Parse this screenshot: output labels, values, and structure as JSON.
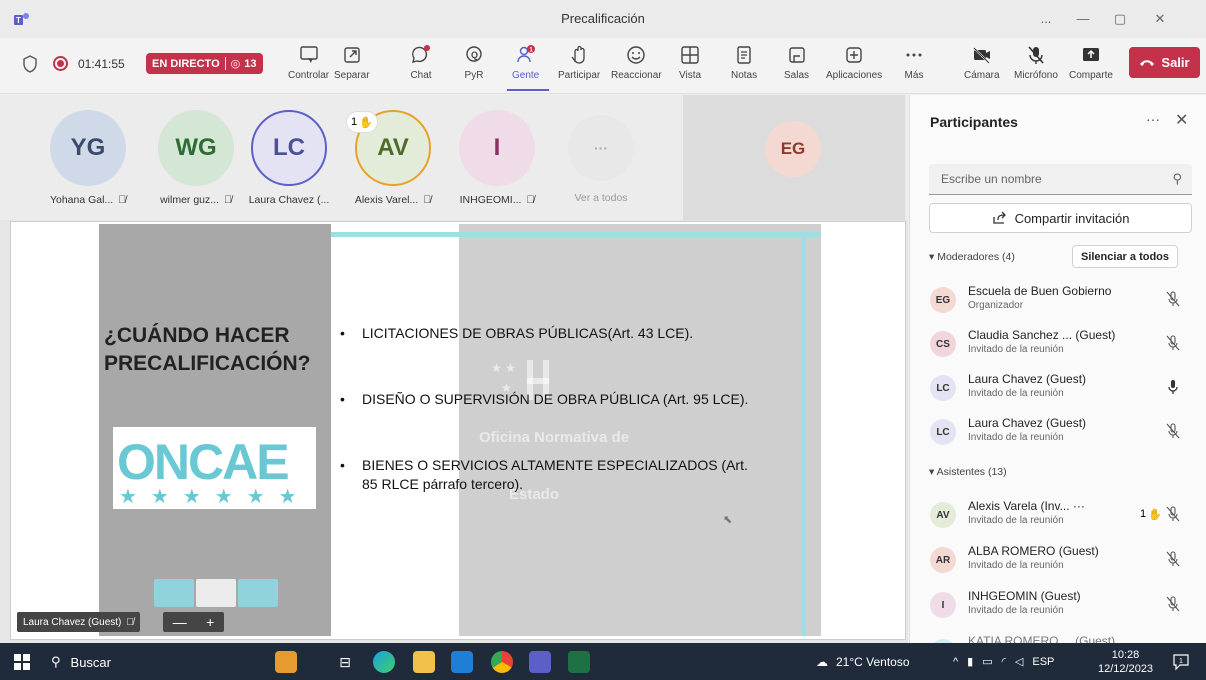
{
  "window": {
    "title": "Precalificación",
    "controls": [
      "...",
      "—",
      "▢",
      "✕"
    ]
  },
  "toolbar": {
    "timer": "01:41:55",
    "live_label": "EN DIRECTO",
    "live_viewers": "13",
    "items": [
      {
        "key": "controlar",
        "label": "Controlar"
      },
      {
        "key": "separar",
        "label": "Separar"
      },
      {
        "key": "chat",
        "label": "Chat"
      },
      {
        "key": "pyr",
        "label": "PyR"
      },
      {
        "key": "gente",
        "label": "Gente",
        "badge": "1"
      },
      {
        "key": "participar",
        "label": "Participar"
      },
      {
        "key": "reaccionar",
        "label": "Reaccionar"
      },
      {
        "key": "vista",
        "label": "Vista"
      },
      {
        "key": "notas",
        "label": "Notas"
      },
      {
        "key": "salas",
        "label": "Salas"
      },
      {
        "key": "aplicaciones",
        "label": "Aplicaciones"
      },
      {
        "key": "mas",
        "label": "Más"
      },
      {
        "key": "camara",
        "label": "Cámara"
      },
      {
        "key": "microfono",
        "label": "Micrófono"
      },
      {
        "key": "comparte",
        "label": "Comparte"
      }
    ],
    "leave_label": "Salir"
  },
  "gallery": {
    "tiles": [
      {
        "initials": "YG",
        "name": "Yohana Gal...",
        "bg": "#cfd9e8",
        "fg": "#3b4a6b"
      },
      {
        "initials": "WG",
        "name": "wilmer guz...",
        "bg": "#d4e6d4",
        "fg": "#2f6b36"
      },
      {
        "initials": "LC",
        "name": "Laura Chavez (...",
        "bg": "#e3e3f3",
        "fg": "#4b4f9c"
      },
      {
        "initials": "AV",
        "name": "Alexis Varel...",
        "bg": "#e3ecd8",
        "fg": "#4e6b2a"
      },
      {
        "initials": "I",
        "name": "INHGEOMI...",
        "bg": "#f0dbe8",
        "fg": "#8c2f64"
      },
      {
        "initials": "···",
        "name": "Ver a todos",
        "bg": "#e8e8e8",
        "fg": "#aaa"
      }
    ],
    "hand_count": "1",
    "featured": {
      "initials": "EG"
    }
  },
  "slide": {
    "title_line1": "¿CUÁNDO HACER",
    "title_line2": "PRECALIFICACIÓN?",
    "bullets": [
      "LICITACIONES DE OBRAS PÚBLICAS(Art. 43 LCE).",
      "DISEÑO O SUPERVISIÓN DE OBRA PÚBLICA (Art. 95 LCE).",
      "BIENES O SERVICIOS ALTAMENTE ESPECIALIZADOS (Art.",
      "85 RLCE párrafo tercero)."
    ],
    "watermark1": "Oficina Normativa de",
    "watermark2": "Estado",
    "logo_text": "ONCAE"
  },
  "presenter": {
    "name": "Laura Chavez (Guest)",
    "zoom_out": "—",
    "zoom_in": "+"
  },
  "panel": {
    "title": "Participantes",
    "more": "···",
    "close": "✕",
    "search_placeholder": "Escribe un nombre",
    "share_invite": "Compartir invitación",
    "moderators_header": "Moderadores (4)",
    "mute_all": "Silenciar a todos",
    "attendees_header": "Asistentes (13)",
    "moderators": [
      {
        "initials": "EG",
        "name": "Escuela de Buen Gobierno",
        "role": "Organizador",
        "bg": "#f4d9d3",
        "mic": "muted"
      },
      {
        "initials": "CS",
        "name": "Claudia Sanchez ... (Guest)",
        "role": "Invitado de la reunión",
        "bg": "#f1d6d9",
        "mic": "muted"
      },
      {
        "initials": "LC",
        "name": "Laura Chavez (Guest)",
        "role": "Invitado de la reunión",
        "bg": "#e3e3f3",
        "mic": "on"
      },
      {
        "initials": "LC",
        "name": "Laura Chavez (Guest)",
        "role": "Invitado de la reunión",
        "bg": "#e3e3f3",
        "mic": "muted"
      }
    ],
    "attendees": [
      {
        "initials": "AV",
        "name": "Alexis Varela (Inv... ···",
        "role": "Invitado de la reunión",
        "bg": "#e3ecd8",
        "mic": "muted",
        "hand": "1"
      },
      {
        "initials": "AR",
        "name": "ALBA ROMERO (Guest)",
        "role": "Invitado de la reunión",
        "bg": "#f4d9d3",
        "mic": "muted"
      },
      {
        "initials": "I",
        "name": "INHGEOMIN (Guest)",
        "role": "Invitado de la reunión",
        "bg": "#f0dbe8",
        "mic": "muted"
      },
      {
        "initials": "",
        "name": "KATIA ROMERO ... (Guest)",
        "role": "",
        "bg": "#d3eef0",
        "mic": "muted"
      }
    ]
  },
  "taskbar": {
    "search_label": "Buscar",
    "weather": "21°C Ventoso",
    "language": "ESP",
    "time": "10:28",
    "date": "12/12/2023",
    "notif_count": "1"
  }
}
